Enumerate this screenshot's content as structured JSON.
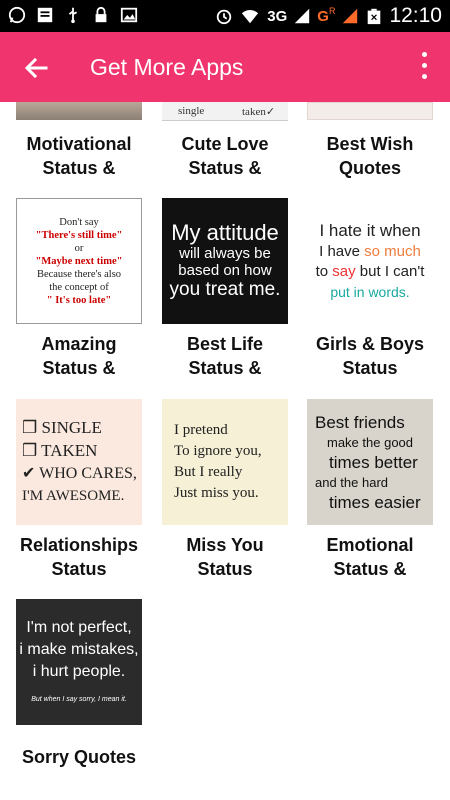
{
  "status_bar": {
    "time": "12:10",
    "network": "3G",
    "network2": "G",
    "network2_sup": "R",
    "icons": [
      "whatsapp-icon",
      "message-icon",
      "usb-icon",
      "lock-icon",
      "image-icon",
      "alarm-icon",
      "wifi-icon",
      "signal-icon",
      "signal-icon-2",
      "battery-icon"
    ]
  },
  "app_bar": {
    "title": "Get More Apps",
    "back_icon": "arrow-left-icon",
    "menu_icon": "more-vertical-icon",
    "color": "#f0346d"
  },
  "grid": {
    "top_partial": {
      "col2_text_left": "single",
      "col2_text_right": "taken✓"
    },
    "items": [
      {
        "label_line1": "Motivational",
        "label_line2": "Status &"
      },
      {
        "label_line1": "Cute Love",
        "label_line2": "Status &"
      },
      {
        "label_line1": "Best Wish",
        "label_line2": "Quotes"
      },
      {
        "label_line1": "Amazing",
        "label_line2": "Status &",
        "tile": {
          "l1": "Don't say",
          "l2": "\"There's still time\"",
          "l3": "or",
          "l4": "\"Maybe next time\"",
          "l5": "Because there's also",
          "l6": "the concept of",
          "l7": "\" It's too late\""
        }
      },
      {
        "label_line1": "Best Life",
        "label_line2": "Status &",
        "tile": {
          "l1": "My attitude",
          "l2": "will always be",
          "l3": "based on how",
          "l4": "you treat me."
        }
      },
      {
        "label_line1": "Girls & Boys",
        "label_line2": "Status",
        "tile": {
          "l1": "I hate it when",
          "l2a": "I have ",
          "l2b": "so much",
          "l3a": "to ",
          "l3b": "say",
          "l3c": " but I can't",
          "l4": "put in words."
        }
      },
      {
        "label_line1": "Relationships",
        "label_line2": "Status",
        "tile": {
          "l1": "❒ SINGLE",
          "l2": "❒ TAKEN",
          "l3": "✔ WHO CARES,",
          "l4": "I'M AWESOME."
        }
      },
      {
        "label_line1": "Miss You",
        "label_line2": "Status",
        "tile": {
          "l1": "I pretend",
          "l2": "To ignore you,",
          "l3": "But I really",
          "l4": "Just miss you."
        }
      },
      {
        "label_line1": "Emotional",
        "label_line2": "Status &",
        "tile": {
          "l1": "Best friends",
          "l2": "make the good",
          "l3": "times better",
          "l4": "and the hard",
          "l5": "times easier"
        }
      },
      {
        "label_line1": "Sorry  Quotes",
        "label_line2": "",
        "tile": {
          "l1": "I'm not perfect,",
          "l2": "i make mistakes,",
          "l3": "i hurt people.",
          "l4": "But when I say sorry, I mean it."
        }
      }
    ]
  }
}
